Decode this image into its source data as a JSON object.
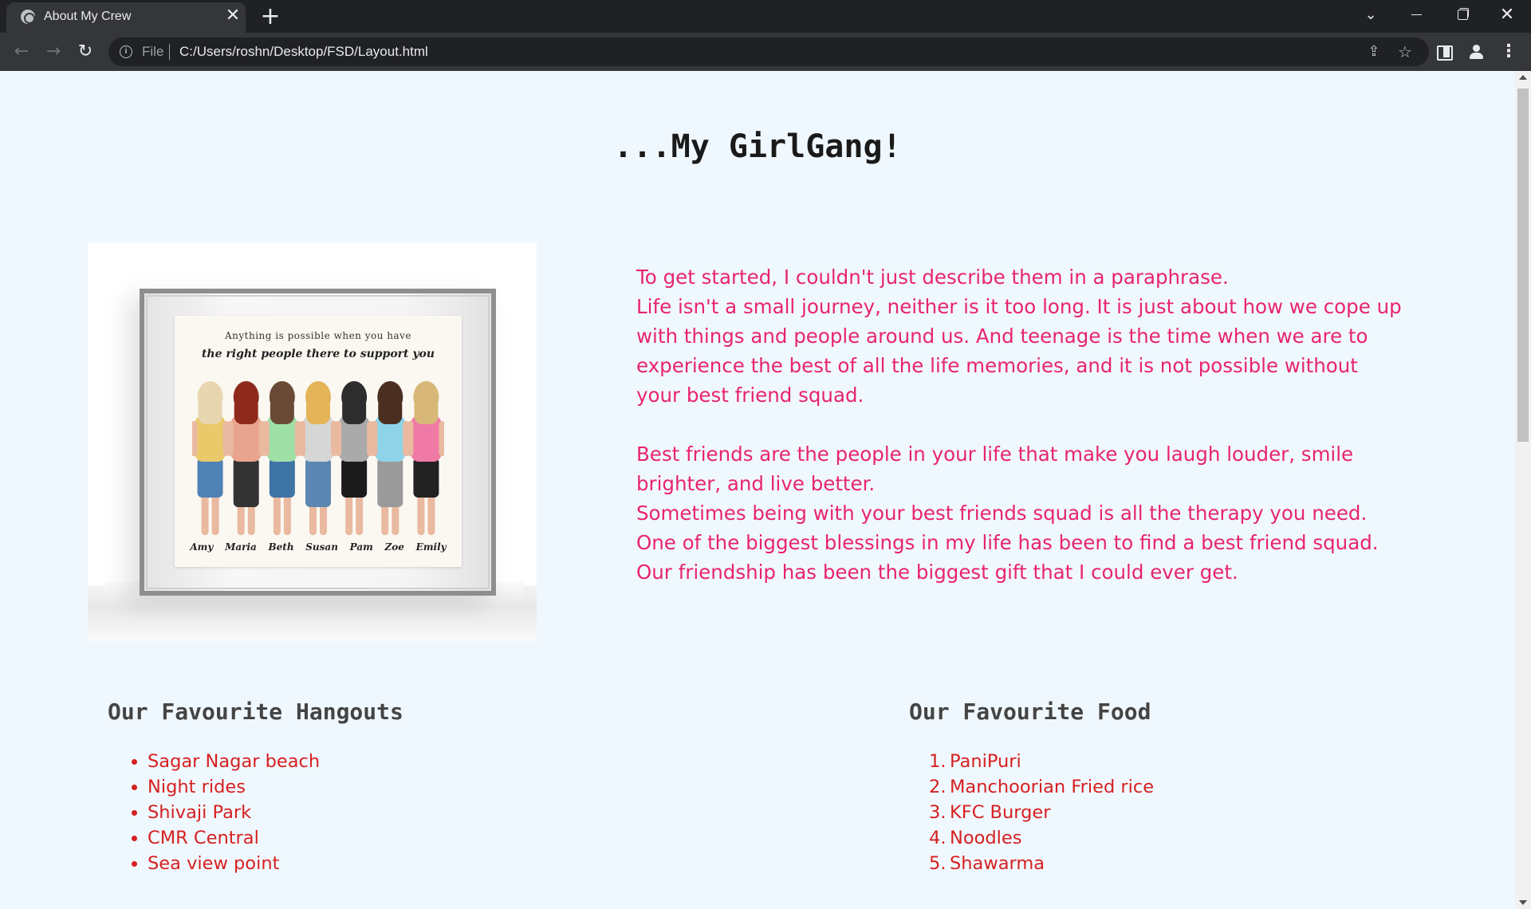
{
  "browser": {
    "tab_title": "About My Crew",
    "tab_close": "✕",
    "new_tab": "+",
    "scheme_label": "File",
    "url": "C:/Users/roshn/Desktop/FSD/Layout.html",
    "icons": [
      "globe-icon",
      "close-icon",
      "plus-icon",
      "chevron-down-icon",
      "minimize-icon",
      "restore-icon",
      "close-icon",
      "back-arrow-icon",
      "forward-arrow-icon",
      "reload-icon",
      "info-icon",
      "share-icon",
      "star-icon",
      "side-panel-icon",
      "profile-icon",
      "kebab-menu-icon"
    ]
  },
  "page": {
    "title": "...My GirlGang!",
    "photo": {
      "quote_line1": "Anything is possible when you have",
      "quote_line2": "the right people there to support you",
      "names": [
        "Amy",
        "Maria",
        "Beth",
        "Susan",
        "Pam",
        "Zoe",
        "Emily"
      ],
      "hair_colors": [
        "#e8d6b0",
        "#8e2a1c",
        "#6a4a36",
        "#e3b458",
        "#2d2d2d",
        "#4a2e20",
        "#d8b878"
      ],
      "top_colors": [
        "#e9c96a",
        "#e9a48f",
        "#9fe0a6",
        "#d6d6d6",
        "#aaaaaa",
        "#8fd3e8",
        "#f07aa6"
      ],
      "bottom_colors": [
        "#4f82b5",
        "#333333",
        "#3f74a6",
        "#5b87b2",
        "#1b1b1b",
        "#9a9a9a",
        "#222222"
      ]
    },
    "intro": {
      "para1": [
        "To get started, I couldn't just describe them in a paraphrase.",
        "Life isn't a small journey, neither is it too long. It is just about how we cope up",
        "with things and people around us. And teenage is the time when we are to",
        "experience the best of all the life memories, and it is not possible without",
        "your best friend squad."
      ],
      "para2": [
        "Best friends are the people in your life that make you laugh louder, smile",
        "brighter, and live better.",
        "Sometimes being with your best friends squad is all the therapy you need.",
        "One of the biggest blessings in my life has been to find a best friend squad.",
        "Our friendship has been the biggest gift that I could ever get."
      ]
    },
    "hangouts": {
      "heading": "Our Favourite Hangouts",
      "items": [
        "Sagar Nagar beach",
        "Night rides",
        "Shivaji Park",
        "CMR Central",
        "Sea view point"
      ]
    },
    "food": {
      "heading": "Our Favourite Food",
      "items": [
        "PaniPuri",
        "Manchoorian Fried rice",
        "KFC Burger",
        "Noodles",
        "Shawarma"
      ]
    },
    "colors": {
      "background": "#f0f8ff",
      "intro_text": "#e8246f",
      "list_text": "#d62020",
      "heading_text": "#444444"
    }
  }
}
